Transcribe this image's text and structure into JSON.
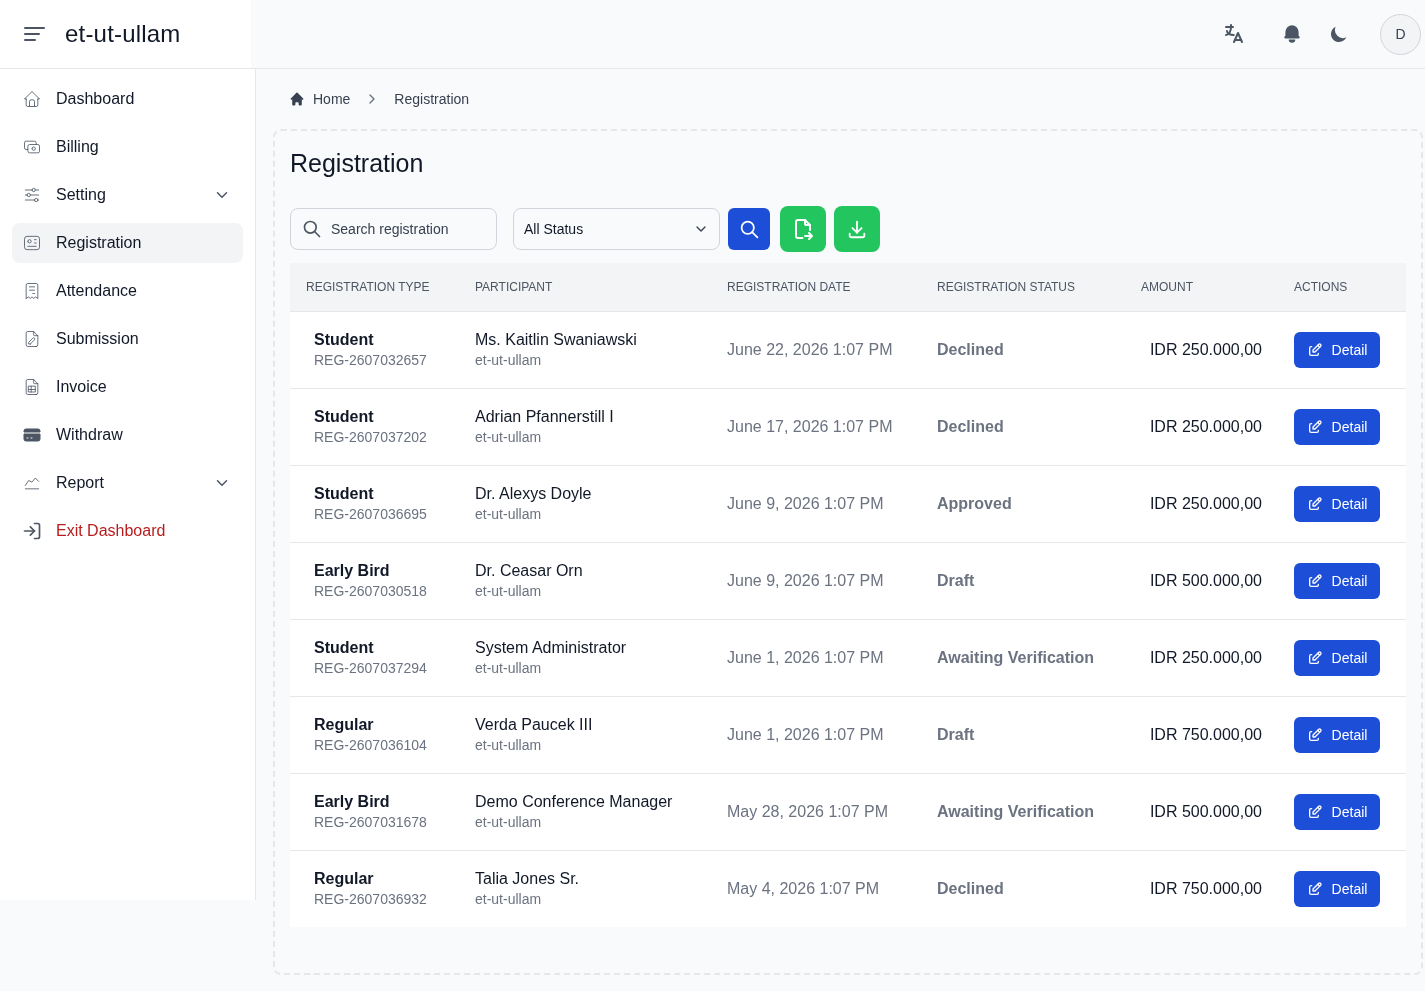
{
  "app": {
    "brand": "et-ut-ullam",
    "avatar_initial": "D"
  },
  "sidebar": {
    "items": [
      {
        "label": "Dashboard",
        "kind": "link",
        "selected": false
      },
      {
        "label": "Billing",
        "kind": "link",
        "selected": false
      },
      {
        "label": "Setting",
        "kind": "group",
        "selected": false
      },
      {
        "label": "Registration",
        "kind": "link",
        "selected": true
      },
      {
        "label": "Attendance",
        "kind": "link",
        "selected": false
      },
      {
        "label": "Submission",
        "kind": "link",
        "selected": false
      },
      {
        "label": "Invoice",
        "kind": "link",
        "selected": false
      },
      {
        "label": "Withdraw",
        "kind": "link",
        "selected": false
      },
      {
        "label": "Report",
        "kind": "group",
        "selected": false
      },
      {
        "label": "Exit Dashboard",
        "kind": "exit",
        "selected": false
      }
    ]
  },
  "breadcrumb": [
    {
      "label": "Home"
    },
    {
      "label": "Registration"
    }
  ],
  "page": {
    "title": "Registration"
  },
  "toolbar": {
    "search": {
      "placeholder": "Search registration"
    },
    "status_filter": {
      "value": "All Status"
    }
  },
  "table": {
    "columns": [
      "REGISTRATION TYPE",
      "PARTICIPANT",
      "REGISTRATION DATE",
      "REGISTRATION STATUS",
      "AMOUNT",
      "ACTIONS"
    ],
    "rows": [
      {
        "type": "Student",
        "code": "REG-2607032657",
        "participant": "Ms. Kaitlin Swaniawski",
        "organization": "et-ut-ullam",
        "date": "June 22, 2026 1:07 PM",
        "status": "Declined",
        "amount": "IDR 250.000,00",
        "action": "Detail"
      },
      {
        "type": "Student",
        "code": "REG-2607037202",
        "participant": "Adrian Pfannerstill I",
        "organization": "et-ut-ullam",
        "date": "June 17, 2026 1:07 PM",
        "status": "Declined",
        "amount": "IDR 250.000,00",
        "action": "Detail"
      },
      {
        "type": "Student",
        "code": "REG-2607036695",
        "participant": "Dr. Alexys Doyle",
        "organization": "et-ut-ullam",
        "date": "June 9, 2026 1:07 PM",
        "status": "Approved",
        "amount": "IDR 250.000,00",
        "action": "Detail"
      },
      {
        "type": "Early Bird",
        "code": "REG-2607030518",
        "participant": "Dr. Ceasar Orn",
        "organization": "et-ut-ullam",
        "date": "June 9, 2026 1:07 PM",
        "status": "Draft",
        "amount": "IDR 500.000,00",
        "action": "Detail"
      },
      {
        "type": "Student",
        "code": "REG-2607037294",
        "participant": "System Administrator",
        "organization": "et-ut-ullam",
        "date": "June 1, 2026 1:07 PM",
        "status": "Awaiting Verification",
        "amount": "IDR 250.000,00",
        "action": "Detail"
      },
      {
        "type": "Regular",
        "code": "REG-2607036104",
        "participant": "Verda Paucek III",
        "organization": "et-ut-ullam",
        "date": "June 1, 2026 1:07 PM",
        "status": "Draft",
        "amount": "IDR 750.000,00",
        "action": "Detail"
      },
      {
        "type": "Early Bird",
        "code": "REG-2607031678",
        "participant": "Demo Conference Manager",
        "organization": "et-ut-ullam",
        "date": "May 28, 2026 1:07 PM",
        "status": "Awaiting Verification",
        "amount": "IDR 500.000,00",
        "action": "Detail"
      },
      {
        "type": "Regular",
        "code": "REG-2607036932",
        "participant": "Talia Jones Sr.",
        "organization": "et-ut-ullam",
        "date": "May 4, 2026 1:07 PM",
        "status": "Declined",
        "amount": "IDR 750.000,00",
        "action": "Detail"
      }
    ]
  }
}
